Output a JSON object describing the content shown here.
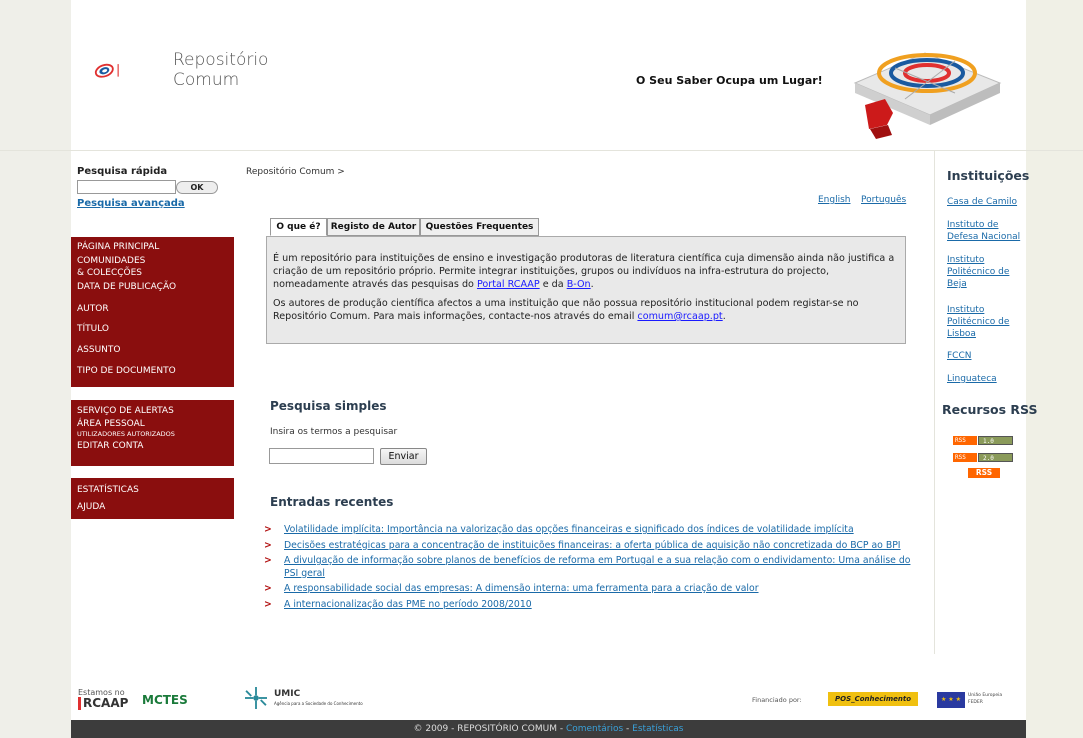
{
  "header": {
    "logo_line1": "Repositório",
    "logo_line2": "Comum",
    "tagline": "O Seu Saber Ocupa um Lugar!"
  },
  "quick_search": {
    "title": "Pesquisa rápida",
    "button": "OK",
    "advanced": "Pesquisa avançada"
  },
  "menu1": [
    {
      "label": "PÁGINA PRINCIPAL"
    },
    {
      "label": "COMUNIDADES"
    },
    {
      "label": "& COLECÇÕES"
    },
    {
      "label": "DATA DE PUBLICAÇÃO"
    },
    {
      "label": "AUTOR"
    },
    {
      "label": "TÍTULO"
    },
    {
      "label": "ASSUNTO"
    },
    {
      "label": "TIPO DE DOCUMENTO"
    }
  ],
  "menu2": {
    "alerts": "SERVIÇO DE ALERTAS",
    "personal": "ÁREA PESSOAL",
    "personal_sub": "UTILIZADORES AUTORIZADOS",
    "edit": "EDITAR CONTA"
  },
  "menu3": {
    "stats": "ESTATÍSTICAS",
    "help": "AJUDA"
  },
  "breadcrumb": "Repositório Comum >",
  "languages": {
    "english": "English",
    "portugues": "Português"
  },
  "tabs": [
    {
      "label": "O que é?"
    },
    {
      "label": "Registo de Autor"
    },
    {
      "label": "Questões Frequentes"
    }
  ],
  "about": {
    "p1_text": "É um repositório para instituições de ensino e investigação produtoras de literatura científica cuja dimensão ainda não justifica a criação de um repositório próprio. Permite integrar instituições, grupos ou indivíduos na infra-estrutura do projecto, nomeadamente através das pesquisas do ",
    "p1_link1": "Portal RCAAP",
    "p1_mid": " e da ",
    "p1_link2": "B-On",
    "p1_end": ".",
    "p2_text": "Os autores de produção científica afectos a uma instituição que não possua repositório institucional podem registar-se no Repositório Comum. Para mais informações, contacte-nos através do email ",
    "p2_link": "comum@rcaap.pt",
    "p2_end": "."
  },
  "simple_search": {
    "title": "Pesquisa simples",
    "label": "Insira os termos a pesquisar",
    "button": "Enviar"
  },
  "recent": {
    "title": "Entradas recentes",
    "items": [
      {
        "bullet": ">",
        "text": "Volatilidade implícita: Importância na valorização das opções financeiras e significado dos índices de volatilidade implícita"
      },
      {
        "bullet": ">",
        "text": "Decisões estratégicas para a concentração de instituições financeiras: a oferta pública de aquisição não concretizada do BCP ao BPI"
      },
      {
        "bullet": ">",
        "text": "A divulgação de informação sobre planos de benefícios de reforma em Portugal e a sua relação com o endividamento: Uma análise do PSI geral"
      },
      {
        "bullet": ">",
        "text": "A responsabilidade social das empresas: A dimensão interna: uma ferramenta para a criação de valor"
      },
      {
        "bullet": ">",
        "text": "A internacionalização das PME no período 2008/2010"
      }
    ]
  },
  "institutions": {
    "title": "Instituições",
    "items": [
      {
        "label": "Casa de Camilo"
      },
      {
        "label": "Instituto de Defesa Nacional"
      },
      {
        "label": "Instituto Politécnico de Beja"
      },
      {
        "label": "Instituto Politécnico de Lisboa"
      },
      {
        "label": "FCCN"
      },
      {
        "label": "Linguateca"
      }
    ]
  },
  "rss": {
    "title": "Recursos RSS",
    "rss_tag": "RSS",
    "v1": "1.0",
    "v2": "2.0",
    "big": "RSS"
  },
  "footer_logos": {
    "rcaap_top": "Estamos no",
    "rcaap_main": "RCAAP",
    "mctes": "MCTES",
    "umic": "UMIC",
    "umic_sub": "Agência para a Sociedade do Conhecimento",
    "financed": "Financiado por:",
    "pos": "POS_Conhecimento",
    "eu": "União Europeia",
    "eu_sub": "FEDER"
  },
  "footer": {
    "copy": "© 2009 - REPOSITÓRIO COMUM - ",
    "comments": "Comentários",
    "sep": " - ",
    "stats": "Estatísticas"
  },
  "colors": {
    "menu": "#8a0e0e",
    "link": "#1a6aa8",
    "bullet": "#b31414",
    "footer": "#3c3c3c"
  }
}
